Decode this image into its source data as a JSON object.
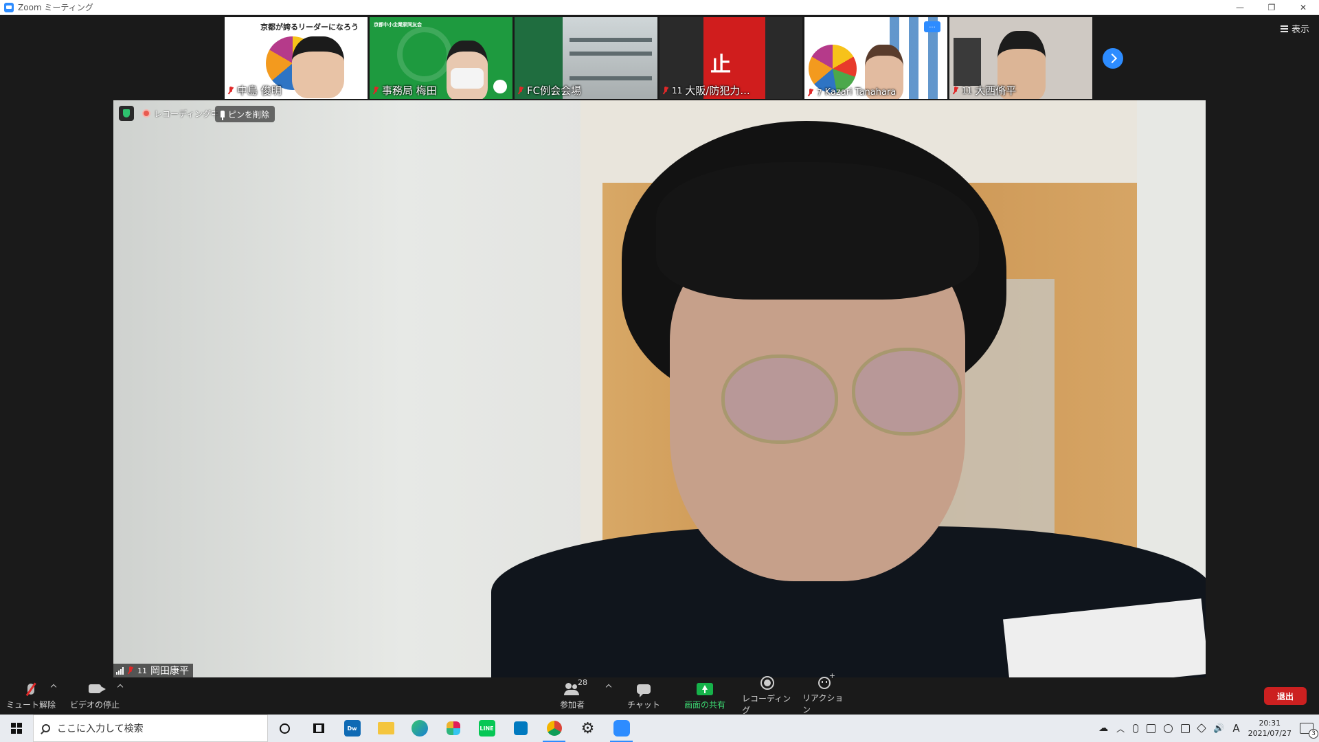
{
  "window": {
    "title": "Zoom ミーティング",
    "controls": [
      "—",
      "❐",
      "✕"
    ]
  },
  "view_button": {
    "label": "表示"
  },
  "thumbnails": [
    {
      "name": "中島 俊明",
      "count": "",
      "slide_text": "京都が誇るリーダーになろう"
    },
    {
      "name": "事務局 梅田",
      "count": "",
      "slide_text": "京都中小企業家同友会"
    },
    {
      "name": "FC例会会場",
      "count": ""
    },
    {
      "name": "大阪/防犯力...",
      "count": "11"
    },
    {
      "name": "Kazari Tanahara",
      "count": "7",
      "more_label": "..."
    },
    {
      "name": "大西脩平",
      "count": "11"
    }
  ],
  "main_video": {
    "recording_label": "レコーディング中",
    "unpin_label": "ピンを削除",
    "participant_name": "岡田康平",
    "participant_count": "11"
  },
  "toolbar": {
    "mute_label": "ミュート解除",
    "video_label": "ビデオの停止",
    "participants_label": "参加者",
    "participants_count": "28",
    "chat_label": "チャット",
    "share_label": "画面の共有",
    "record_label": "レコーディング",
    "reaction_label": "リアクション",
    "leave_label": "退出",
    "share_color": "#16b24a",
    "leave_color": "#cc2020"
  },
  "taskbar": {
    "search_placeholder": "ここに入力して検索",
    "apps": [
      "dreamweaver-icon",
      "file-explorer-icon",
      "edge-icon",
      "slack-icon",
      "line-icon",
      "trello-icon",
      "chrome-icon",
      "settings-icon",
      "zoom-icon"
    ],
    "dw_label": "Dw",
    "line_label": "LINE",
    "time": "20:31",
    "date": "2021/07/27",
    "ime": "A",
    "notification_count": "3"
  }
}
